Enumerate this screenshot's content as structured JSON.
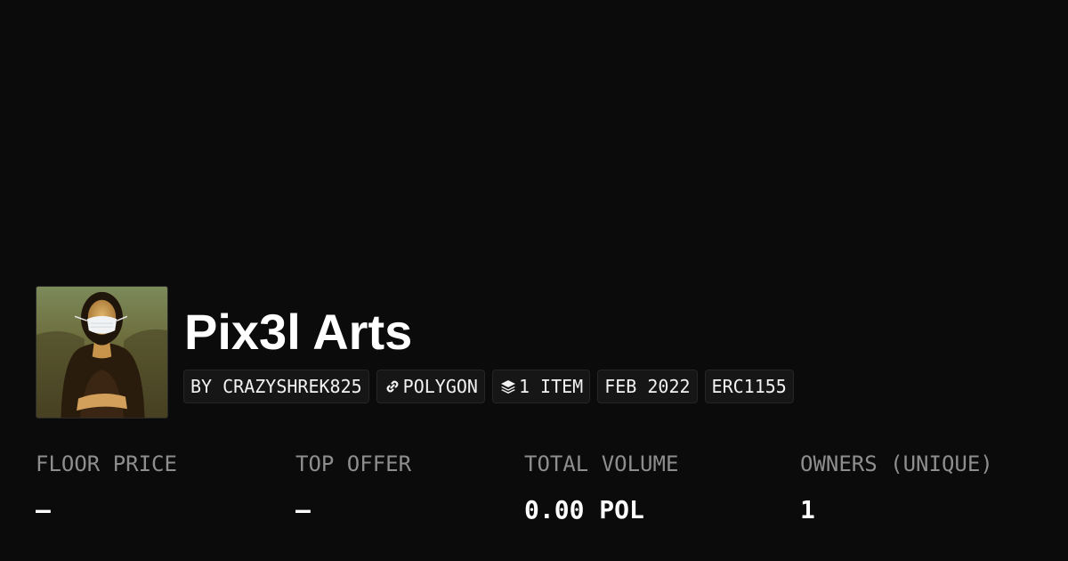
{
  "collection": {
    "name": "Pix3l Arts",
    "avatar_icon": "mona-lisa-face-mask-image"
  },
  "tags": [
    {
      "label": "BY CRAZYSHREK825",
      "icon": ""
    },
    {
      "label": "POLYGON",
      "icon": "chain-link-icon"
    },
    {
      "label": "1 ITEM",
      "icon": "layers-icon"
    },
    {
      "label": "FEB 2022",
      "icon": ""
    },
    {
      "label": "ERC1155",
      "icon": ""
    }
  ],
  "stats": [
    {
      "label": "FLOOR PRICE",
      "value": "–"
    },
    {
      "label": "TOP OFFER",
      "value": "–"
    },
    {
      "label": "TOTAL VOLUME",
      "value": "0.00 POL"
    },
    {
      "label": "OWNERS (UNIQUE)",
      "value": "1"
    }
  ],
  "colors": {
    "background": "#0b0b0b",
    "text": "#ffffff",
    "muted": "#8e8e8e",
    "tag_bg": "#161616"
  }
}
